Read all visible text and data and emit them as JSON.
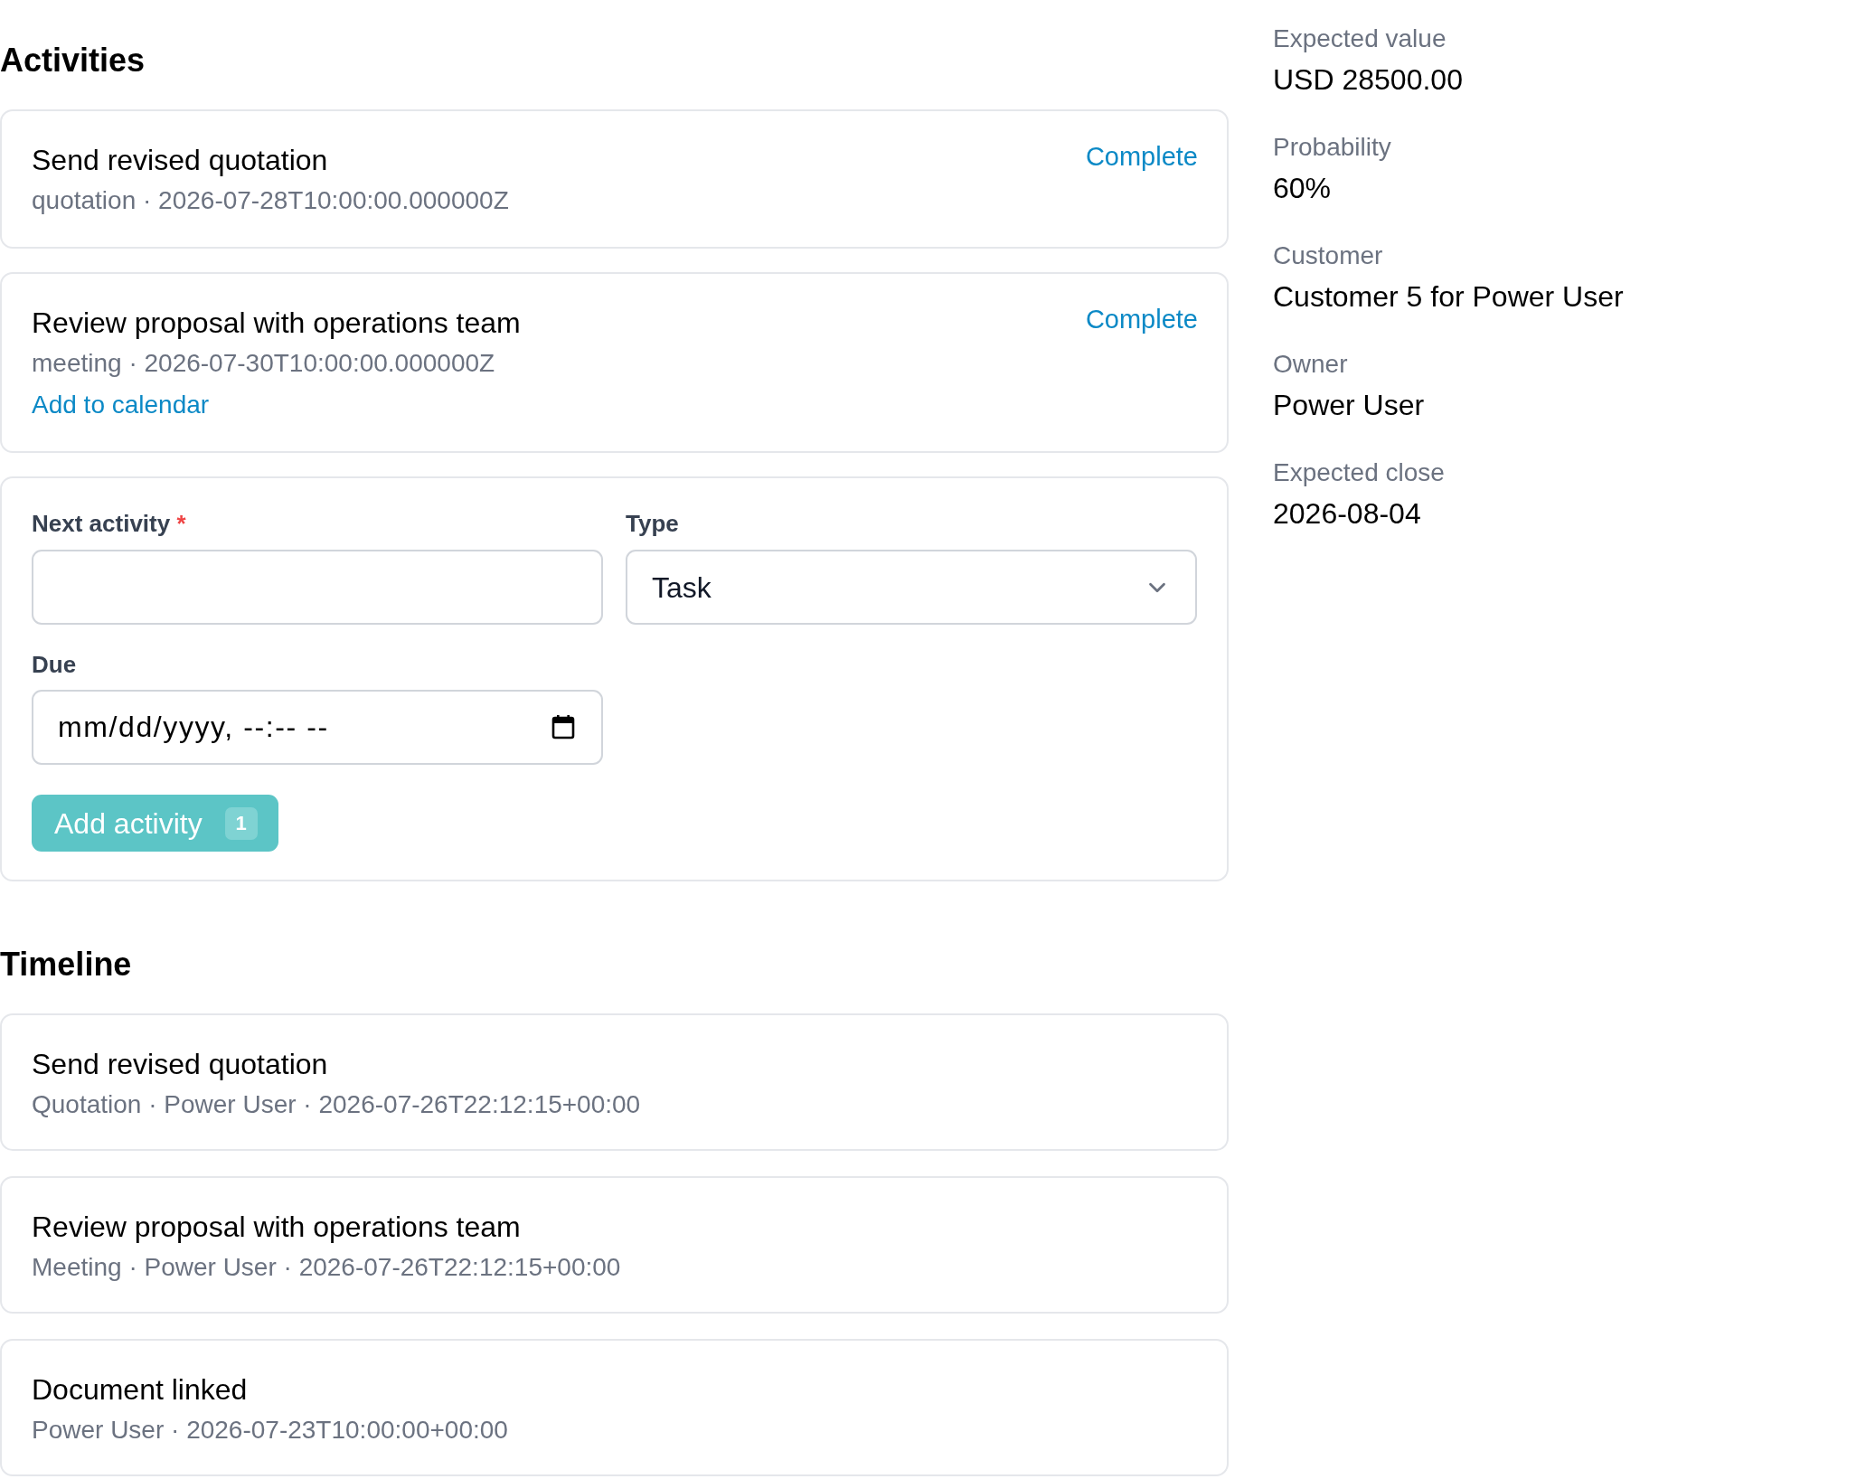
{
  "activities": {
    "title": "Activities",
    "items": [
      {
        "title": "Send revised quotation",
        "meta": "quotation · 2026-07-28T10:00:00.000000Z",
        "action": "Complete"
      },
      {
        "title": "Review proposal with operations team",
        "meta": "meeting · 2026-07-30T10:00:00.000000Z",
        "action": "Complete",
        "link": "Add to calendar"
      }
    ]
  },
  "form": {
    "fields": [
      {
        "kind": "text",
        "label": "Next activity",
        "required_mark": "*"
      },
      {
        "kind": "select",
        "label": "Type",
        "value": "Task"
      },
      {
        "kind": "datetime",
        "label": "Due",
        "placeholder": "mm/dd/yyyy, --:-- --"
      }
    ],
    "submit": {
      "label": "Add activity",
      "badge": "1"
    }
  },
  "timeline": {
    "title": "Timeline",
    "items": [
      {
        "title": "Send revised quotation",
        "meta": "Quotation · Power User · 2026-07-26T22:12:15+00:00"
      },
      {
        "title": "Review proposal with operations team",
        "meta": "Meeting · Power User · 2026-07-26T22:12:15+00:00"
      },
      {
        "title": "Document linked",
        "meta": "Power User · 2026-07-23T10:00:00+00:00"
      }
    ]
  },
  "details": [
    {
      "label": "Expected value",
      "value": "USD 28500.00"
    },
    {
      "label": "Probability",
      "value": "60%"
    },
    {
      "label": "Customer",
      "value": "Customer 5 for Power User"
    },
    {
      "label": "Owner",
      "value": "Power User"
    },
    {
      "label": "Expected close",
      "value": "2026-08-04"
    }
  ]
}
